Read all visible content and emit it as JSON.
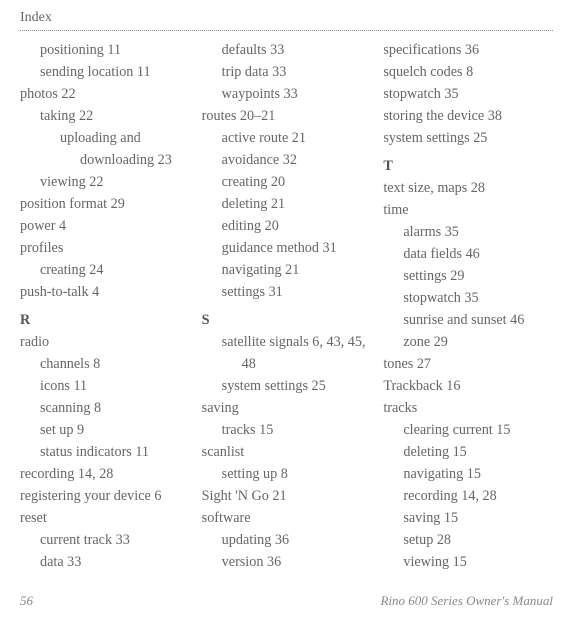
{
  "header": {
    "title": "Index"
  },
  "footer": {
    "page": "56",
    "manual": "Rino 600 Series Owner's Manual"
  },
  "cols": {
    "c1": {
      "l1": "positioning  11",
      "l2": "sending location  11",
      "l3": "photos  22",
      "l4": "taking  22",
      "l5": "uploading and downloading  23",
      "l6": "viewing  22",
      "l7": "position format  29",
      "l8": "power  4",
      "l9": "profiles",
      "l10": "creating  24",
      "l11": "push-to-talk  4",
      "secR": "R",
      "l12": "radio",
      "l13": "channels  8",
      "l14": "icons  11",
      "l15": "scanning  8",
      "l16": "set up  9",
      "l17": "status indicators  11",
      "l18": "recording  14, 28",
      "l19": "registering your device  6",
      "l20": "reset",
      "l21": "current track  33",
      "l22": "data  33"
    },
    "c2": {
      "l1": "defaults  33",
      "l2": "trip data  33",
      "l3": "waypoints  33",
      "l4": "routes  20–21",
      "l5": "active route  21",
      "l6": "avoidance  32",
      "l7": "creating  20",
      "l8": "deleting  21",
      "l9": "editing  20",
      "l10": "guidance method  31",
      "l11": "navigating  21",
      "l12": "settings  31",
      "secS": "S",
      "l13": "satellite signals  6, 43, 45, 48",
      "l14": "system settings  25",
      "l15": "saving",
      "l16": "tracks  15",
      "l17": "scanlist",
      "l18": "setting up  8",
      "l19": "Sight 'N Go  21",
      "l20": "software",
      "l21": "updating  36",
      "l22": "version  36"
    },
    "c3": {
      "l1": "specifications  36",
      "l2": "squelch codes  8",
      "l3": "stopwatch  35",
      "l4": "storing the device  38",
      "l5": "system settings  25",
      "secT": "T",
      "l6": "text size, maps  28",
      "l7": "time",
      "l8": "alarms  35",
      "l9": "data fields  46",
      "l10": "settings  29",
      "l11": "stopwatch  35",
      "l12": "sunrise and sunset  46",
      "l13": "zone  29",
      "l14": "tones  27",
      "l15": "Trackback  16",
      "l16": "tracks",
      "l17": "clearing current  15",
      "l18": "deleting  15",
      "l19": "navigating  15",
      "l20": "recording  14, 28",
      "l21": "saving  15",
      "l22": "setup  28",
      "l23": "viewing  15"
    }
  }
}
